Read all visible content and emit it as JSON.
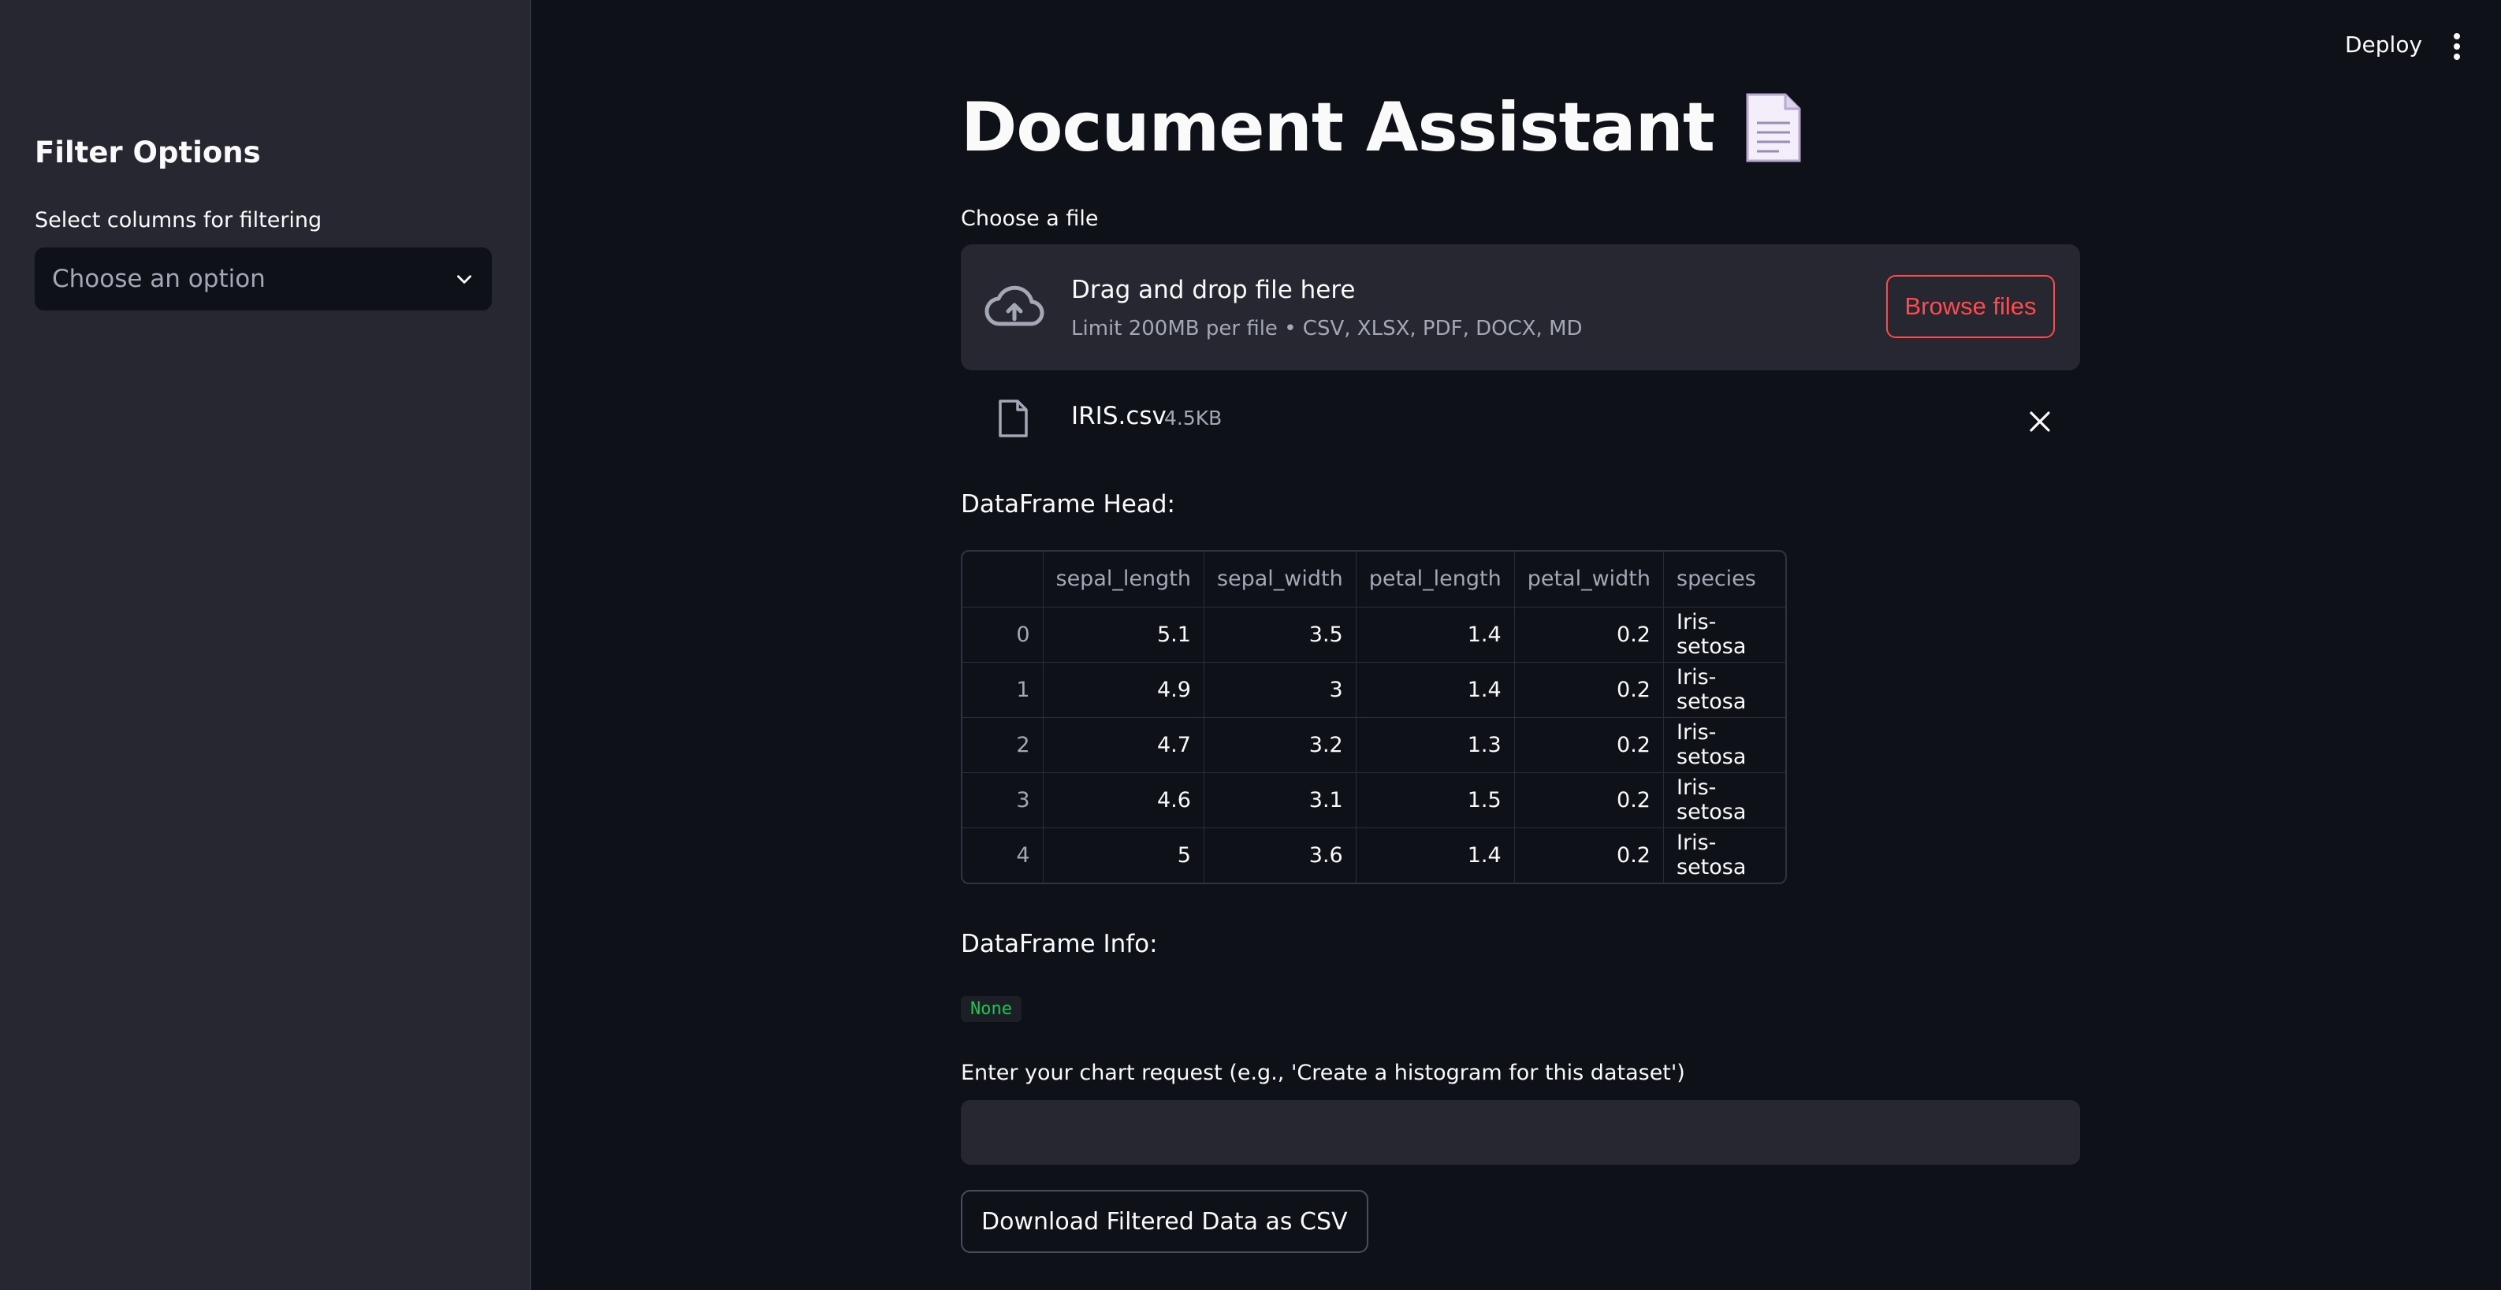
{
  "header": {
    "deploy_label": "Deploy"
  },
  "sidebar": {
    "title": "Filter Options",
    "select_label": "Select columns for filtering",
    "select_placeholder": "Choose an option"
  },
  "main": {
    "title": "Document Assistant",
    "file_label": "Choose a file",
    "uploader": {
      "drag_text": "Drag and drop file here",
      "limit_text": "Limit 200MB per file • CSV, XLSX, PDF, DOCX, MD",
      "browse_label": "Browse files"
    },
    "uploaded_file": {
      "name": "IRIS.csv",
      "size": "4.5KB"
    },
    "df_head_label": "DataFrame Head:",
    "table": {
      "columns": [
        "sepal_length",
        "sepal_width",
        "petal_length",
        "petal_width",
        "species"
      ],
      "rows": [
        [
          "0",
          "5.1",
          "3.5",
          "1.4",
          "0.2",
          "Iris-setosa"
        ],
        [
          "1",
          "4.9",
          "3",
          "1.4",
          "0.2",
          "Iris-setosa"
        ],
        [
          "2",
          "4.7",
          "3.2",
          "1.3",
          "0.2",
          "Iris-setosa"
        ],
        [
          "3",
          "4.6",
          "3.1",
          "1.5",
          "0.2",
          "Iris-setosa"
        ],
        [
          "4",
          "5",
          "3.6",
          "1.4",
          "0.2",
          "Iris-setosa"
        ]
      ]
    },
    "df_info_label": "DataFrame Info:",
    "df_info_value": "None",
    "chart_request_label": "Enter your chart request (e.g., 'Create a histogram for this dataset')",
    "chart_request_value": "",
    "download_label": "Download Filtered Data as CSV"
  },
  "colors": {
    "background": "#0e1117",
    "sidebar": "#262730",
    "accent": "#ff4b4b",
    "code_green": "#21c354"
  },
  "icons": [
    "chevron-down-icon",
    "kebab-menu-icon",
    "document-icon",
    "cloud-upload-icon",
    "file-icon",
    "close-icon"
  ]
}
